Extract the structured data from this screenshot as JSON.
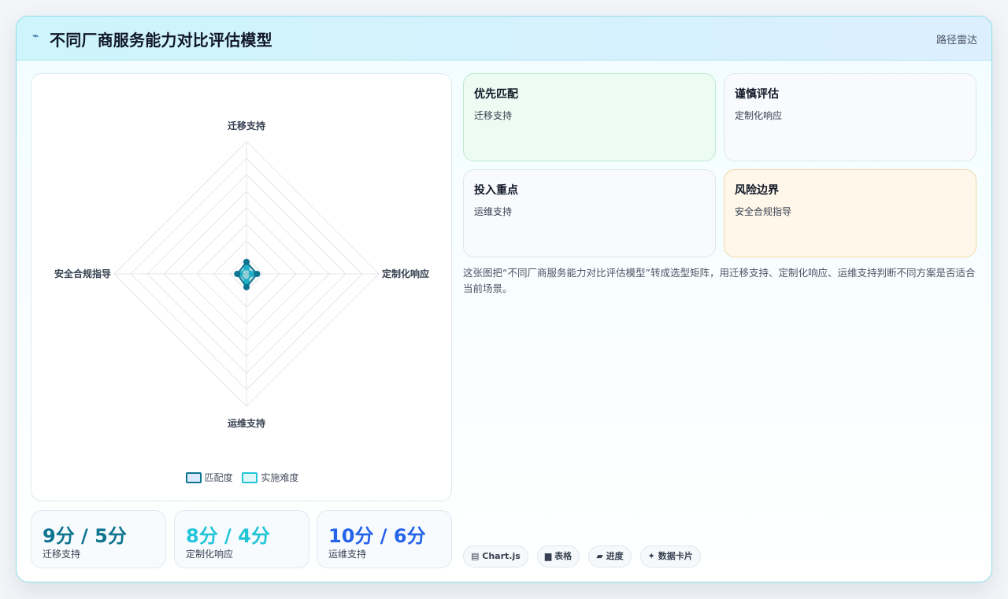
{
  "header": {
    "icon": "⌁",
    "title": "不同厂商服务能力对比评估模型",
    "badge": "路径雷达"
  },
  "chart_data": {
    "type": "radar",
    "axes": [
      "迁移支持",
      "定制化响应",
      "运维支持",
      "安全合规指导"
    ],
    "range": [
      0,
      100
    ],
    "grid_levels": 8,
    "series": [
      {
        "name": "匹配度",
        "values": [
          9,
          8,
          10,
          7
        ],
        "color": "#0e7490"
      },
      {
        "name": "实施难度",
        "values": [
          5,
          4,
          6,
          5
        ],
        "color": "#22c5d8"
      }
    ],
    "legend_position": "bottom"
  },
  "stats": [
    {
      "value": "9分 / 5分",
      "label": "迁移支持",
      "color": "#0e7490"
    },
    {
      "value": "8分 / 4分",
      "label": "定制化响应",
      "color": "#22c5d8"
    },
    {
      "value": "10分 / 6分",
      "label": "运维支持",
      "color": "#2563eb"
    }
  ],
  "quadrants": [
    {
      "title": "优先匹配",
      "text": "迁移支持",
      "bg": "#ecfcf3",
      "border": "#bfe9d0"
    },
    {
      "title": "谨慎评估",
      "text": "定制化响应",
      "bg": "#f8fafd",
      "border": "#dfe8ee"
    },
    {
      "title": "投入重点",
      "text": "运维支持",
      "bg": "#f8fafd",
      "border": "#dfe8ee"
    },
    {
      "title": "风险边界",
      "text": "安全合规指导",
      "bg": "#fff7ea",
      "border": "#f3d8a8"
    }
  ],
  "description": "这张图把“不同厂商服务能力对比评估模型”转成选型矩阵，用迁移支持、定制化响应、运维支持判断不同方案是否适合当前场景。",
  "chips": [
    {
      "icon": "▤",
      "label": "Chart.js"
    },
    {
      "icon": "▆",
      "label": "表格"
    },
    {
      "icon": "▰",
      "label": "进度"
    },
    {
      "icon": "✦",
      "label": "数据卡片"
    }
  ]
}
